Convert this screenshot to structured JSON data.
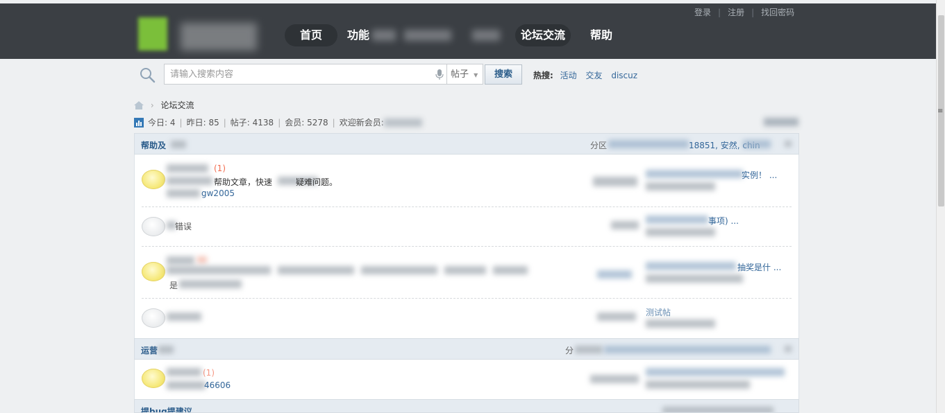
{
  "header": {
    "top_links": [
      "登录",
      "注册",
      "找回密码"
    ],
    "nav": [
      {
        "label": "首页",
        "active": true
      },
      {
        "label": "功能",
        "active": false
      },
      {
        "label": "论坛交流",
        "active": true
      },
      {
        "label": "帮助",
        "active": false
      }
    ]
  },
  "search": {
    "placeholder": "请输入搜索内容",
    "type": "帖子",
    "button": "搜索",
    "hot_label": "热搜:",
    "hot": [
      "活动",
      "交友",
      "discuz"
    ]
  },
  "breadcrumb": {
    "current": "论坛交流"
  },
  "stats": {
    "today_label": "今日:",
    "today": "4",
    "yesterday_label": "昨日:",
    "yesterday": "85",
    "posts_label": "帖子:",
    "posts": "4138",
    "members_label": "会员:",
    "members": "5278",
    "welcome": "欢迎新会员:"
  },
  "categories": [
    {
      "title": "帮助及",
      "moderators_label": "分区",
      "moderators_visible": "18851, 安然, chin",
      "forums": [
        {
          "today_badge": "(1)",
          "desc": "帮助文章，快速",
          "desc2": "疑难问题。",
          "mod": "gw2005",
          "last_post": "实例！ ...",
          "icon": "yellow"
        },
        {
          "name": "错误",
          "last_post": "事项) ...",
          "icon": "gray"
        },
        {
          "last_post": "抽奖是什 ...",
          "desc": "是",
          "icon": "yellow"
        },
        {
          "last_post": "测试帖",
          "icon": "gray"
        }
      ]
    },
    {
      "title": "运营",
      "moderators_label": "分",
      "forums": [
        {
          "today_badge": "(1)",
          "mod": "46606",
          "icon": "yellow"
        }
      ]
    },
    {
      "title": "提bug提建议"
    }
  ],
  "colors": {
    "topbar": "#3b3f44",
    "link": "#336699",
    "category_bg": "#e5ebf1"
  }
}
